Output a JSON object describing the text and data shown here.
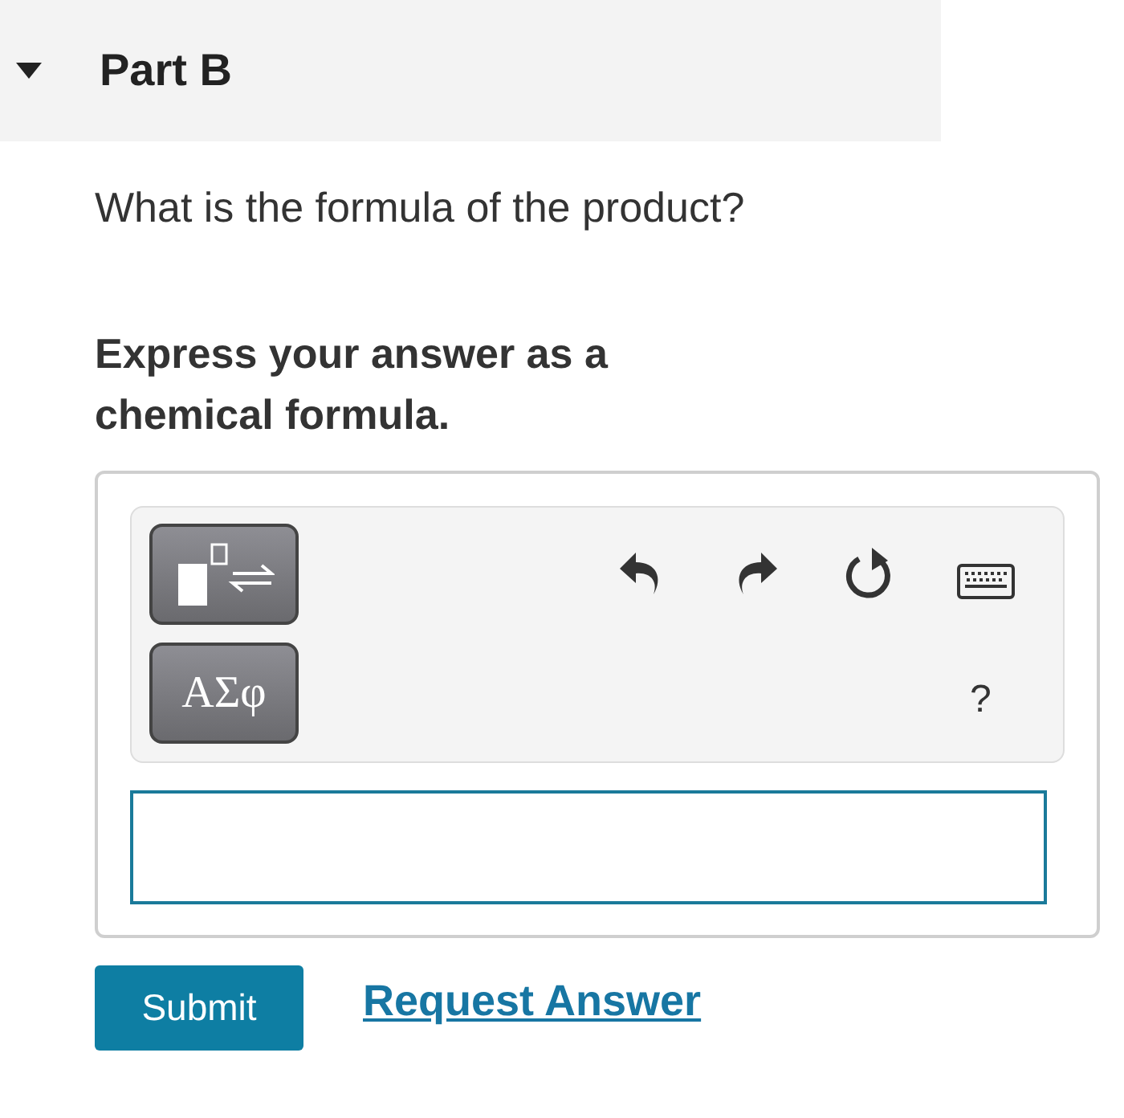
{
  "part": {
    "title": "Part B",
    "expanded": true
  },
  "question": "What is the formula of the product?",
  "instruction": "Express your answer as a chemical formula.",
  "toolbar": {
    "symbols_button": "ΑΣφ",
    "help": "?"
  },
  "actions": {
    "submit": "Submit",
    "request": "Request Answer"
  }
}
